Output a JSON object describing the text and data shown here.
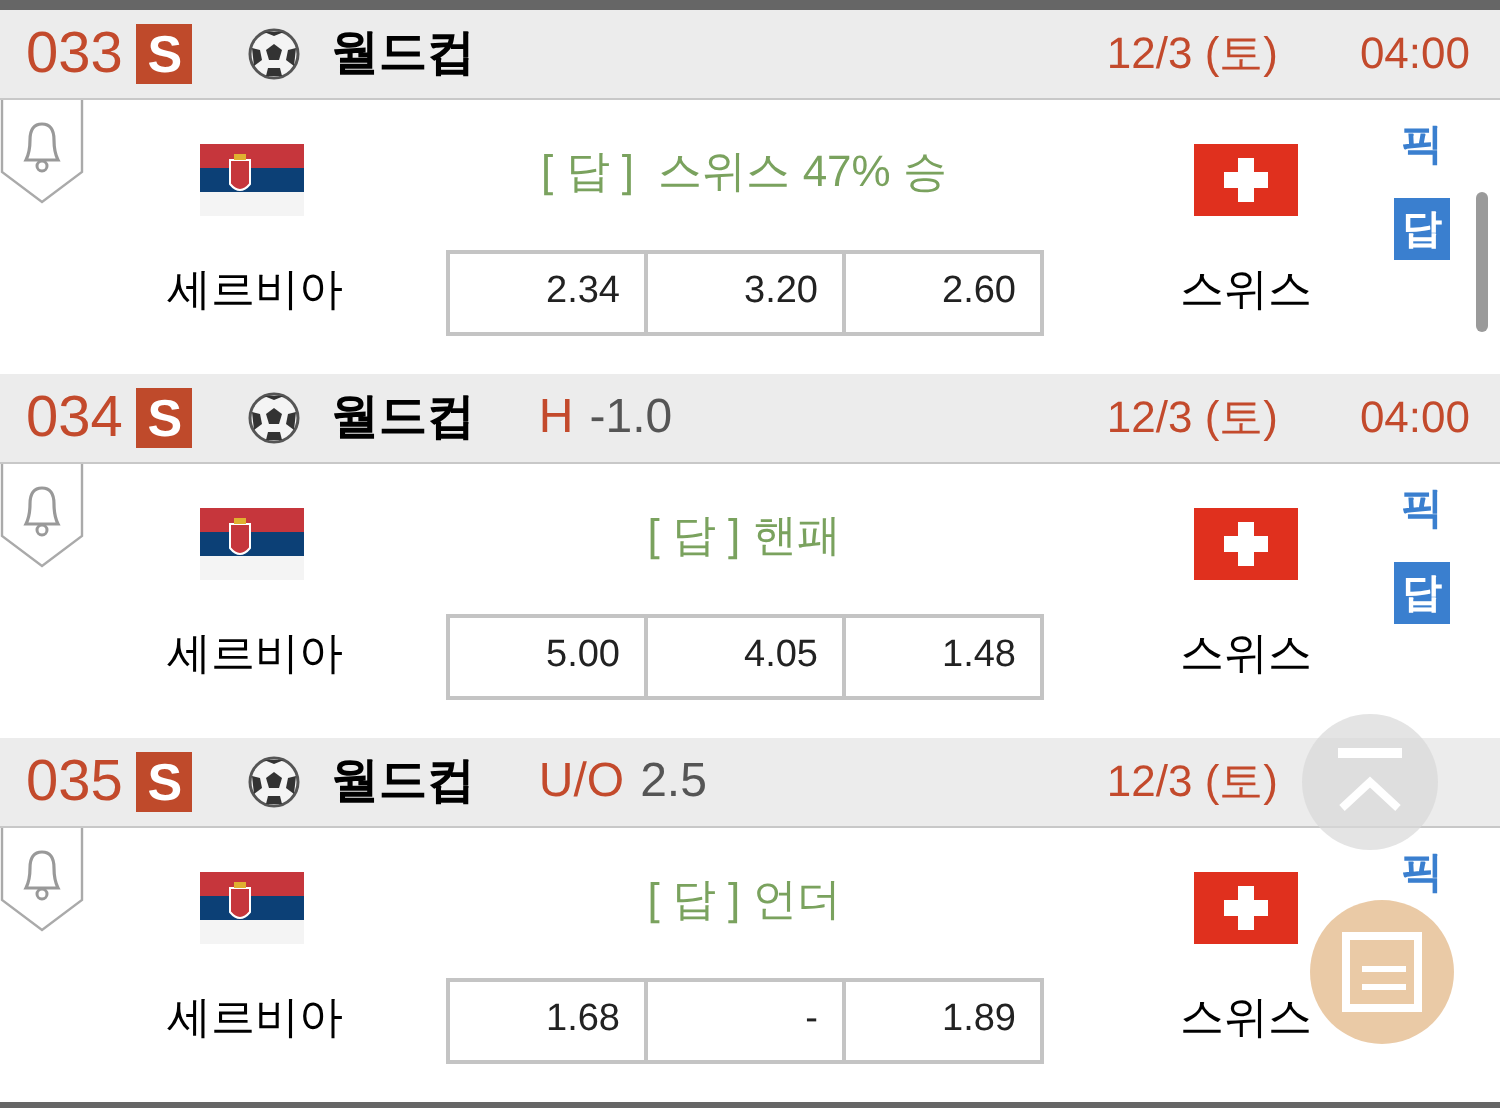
{
  "matches": [
    {
      "number": "033",
      "badge": "S",
      "league": "월드컵",
      "date": "12/3 (토)",
      "time": "04:00",
      "prediction": "[ 답 ]  스위스 47% 승",
      "home": "세르비아",
      "away": "스위스",
      "odds": [
        "2.34",
        "3.20",
        "2.60"
      ],
      "pick": "픽",
      "answer": "답"
    },
    {
      "number": "034",
      "badge": "S",
      "league": "월드컵",
      "handicap": {
        "label": "H",
        "value": "-1.0"
      },
      "date": "12/3 (토)",
      "time": "04:00",
      "prediction": "[ 답 ] 핸패",
      "home": "세르비아",
      "away": "스위스",
      "odds": [
        "5.00",
        "4.05",
        "1.48"
      ],
      "pick": "픽",
      "answer": "답"
    },
    {
      "number": "035",
      "badge": "S",
      "league": "월드컵",
      "handicap": {
        "label": "U/O",
        "value": "2.5"
      },
      "date": "12/3 (토)",
      "prediction": "[ 답 ] 언더",
      "home": "세르비아",
      "away": "스위스",
      "odds": [
        "1.68",
        "-",
        "1.89"
      ],
      "pick": "픽"
    }
  ]
}
